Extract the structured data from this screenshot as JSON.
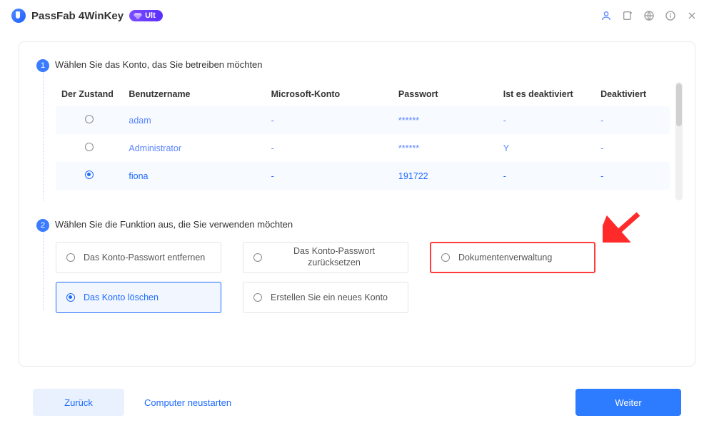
{
  "titlebar": {
    "app_name": "PassFab 4WinKey",
    "badge": "Ult"
  },
  "step1": {
    "label": "Wählen Sie das Konto, das Sie betreiben möchten"
  },
  "table": {
    "headers": {
      "state": "Der Zustand",
      "user": "Benutzername",
      "ms": "Microsoft-Konto",
      "pw": "Passwort",
      "disabled": "Ist es deaktiviert",
      "deak": "Deaktiviert"
    },
    "rows": [
      {
        "user": "adam",
        "ms": "-",
        "pw": "******",
        "disabled": "-",
        "deak": "-",
        "selected": false
      },
      {
        "user": "Administrator",
        "ms": "-",
        "pw": "******",
        "disabled": "Y",
        "deak": "-",
        "selected": false
      },
      {
        "user": "fiona",
        "ms": "-",
        "pw": "191722",
        "disabled": "-",
        "deak": "-",
        "selected": true
      }
    ]
  },
  "step2": {
    "label": "Wählen Sie die Funktion aus, die Sie verwenden möchten"
  },
  "options": {
    "remove": "Das Konto-Passwort entfernen",
    "reset": "Das Konto-Passwort zurücksetzen",
    "docs": "Dokumentenverwaltung",
    "delete": "Das Konto löschen",
    "create": "Erstellen Sie ein neues Konto"
  },
  "footer": {
    "back": "Zurück",
    "restart": "Computer neustarten",
    "next": "Weiter"
  }
}
